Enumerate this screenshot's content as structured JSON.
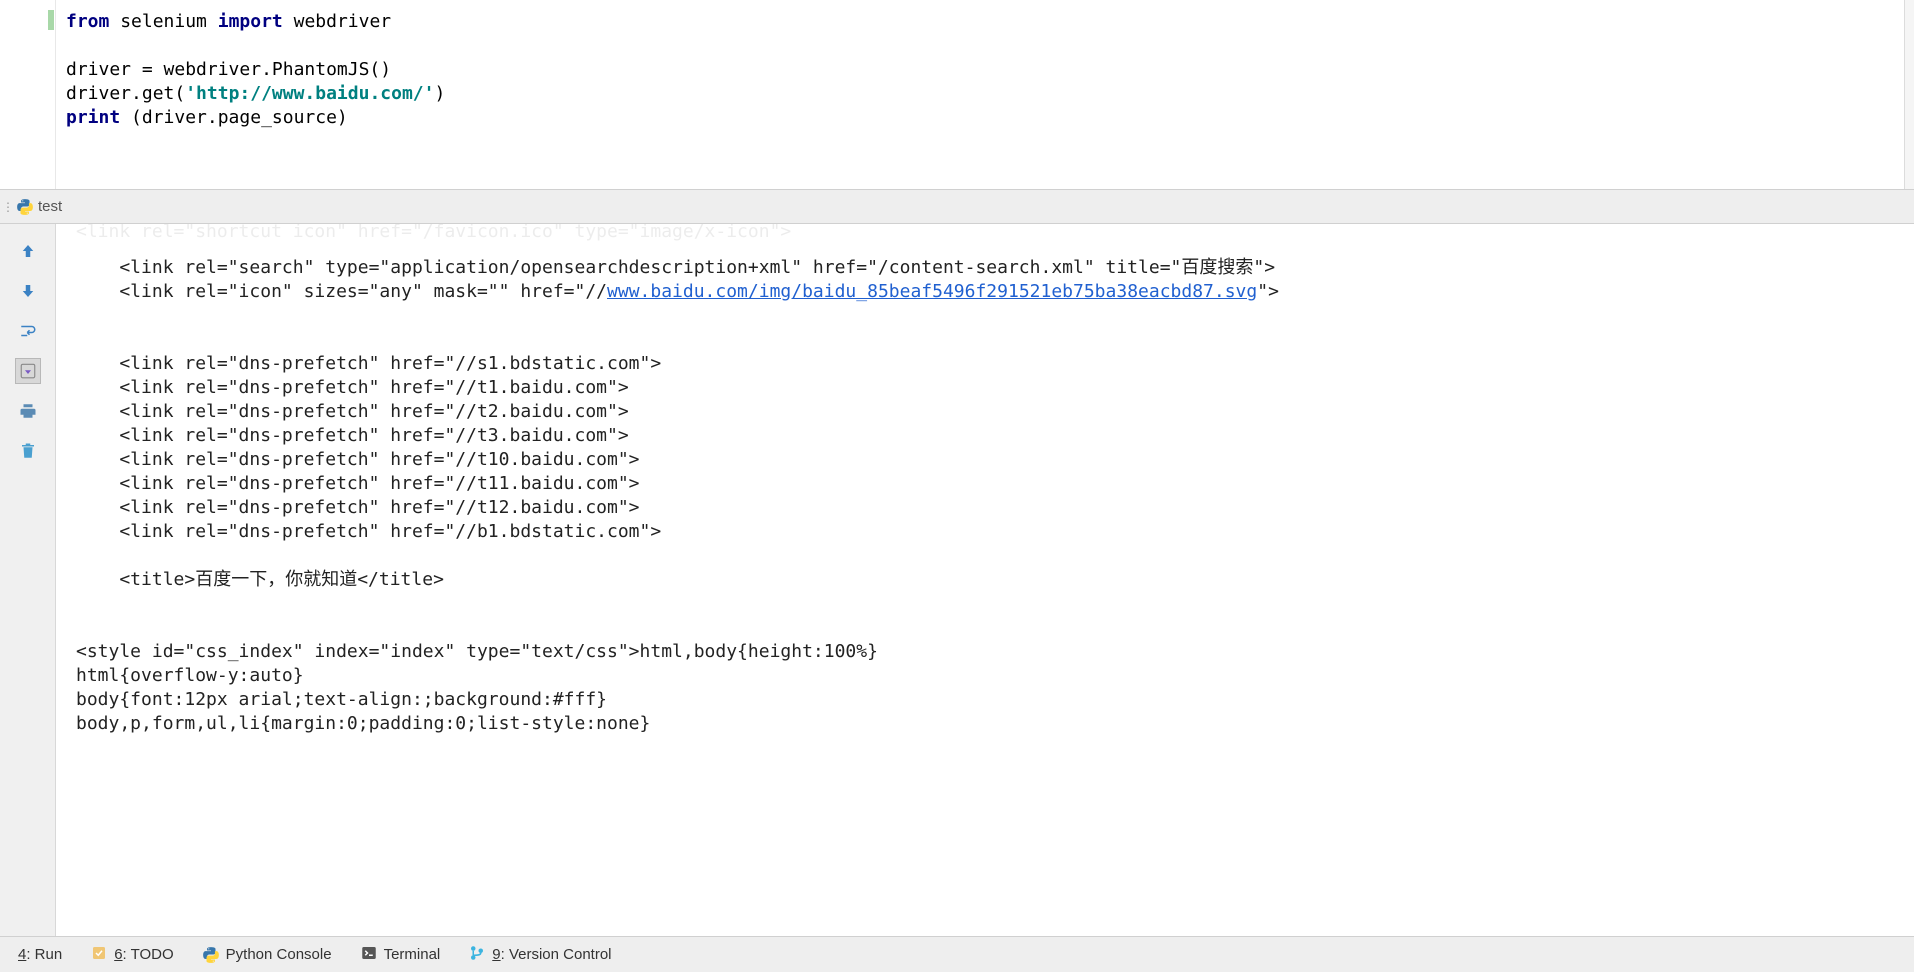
{
  "editor": {
    "code": {
      "line1_from": "from",
      "line1_mod": " selenium ",
      "line1_import": "import",
      "line1_rest": " webdriver",
      "line2": "",
      "line3": "driver = webdriver.PhantomJS()",
      "line4_pre": "driver.get(",
      "line4_str": "'http://www.baidu.com/'",
      "line4_post": ")",
      "line5_print": "print",
      "line5_rest": " (driver.page_source)"
    }
  },
  "run_tab": {
    "label": "test"
  },
  "output": {
    "cutoff_line": "<link rel=\"shortcut icon\" href=\"/favicon.ico\" type=\"image/x-icon\">",
    "line1": "    <link rel=\"search\" type=\"application/opensearchdescription+xml\" href=\"/content-search.xml\" title=\"百度搜索\">",
    "line2_pre": "    <link rel=\"icon\" sizes=\"any\" mask=\"\" href=\"//",
    "line2_link": "www.baidu.com/img/baidu_85beaf5496f291521eb75ba38eacbd87.svg",
    "line2_post": "\">",
    "blank1": "",
    "blank2": "",
    "line3": "    <link rel=\"dns-prefetch\" href=\"//s1.bdstatic.com\">",
    "line4": "    <link rel=\"dns-prefetch\" href=\"//t1.baidu.com\">",
    "line5": "    <link rel=\"dns-prefetch\" href=\"//t2.baidu.com\">",
    "line6": "    <link rel=\"dns-prefetch\" href=\"//t3.baidu.com\">",
    "line7": "    <link rel=\"dns-prefetch\" href=\"//t10.baidu.com\">",
    "line8": "    <link rel=\"dns-prefetch\" href=\"//t11.baidu.com\">",
    "line9": "    <link rel=\"dns-prefetch\" href=\"//t12.baidu.com\">",
    "line10": "    <link rel=\"dns-prefetch\" href=\"//b1.bdstatic.com\">",
    "blank3": "",
    "line11": "    <title>百度一下，你就知道</title>",
    "blank4": "",
    "blank5": "",
    "line12": "<style id=\"css_index\" index=\"index\" type=\"text/css\">html,body{height:100%}",
    "line13": "html{overflow-y:auto}",
    "line14": "body{font:12px arial;text-align:;background:#fff}",
    "line15": "body,p,form,ul,li{margin:0;padding:0;list-style:none}"
  },
  "bottom_bar": {
    "run": {
      "num": "4",
      "label": ": Run"
    },
    "todo": {
      "num": "6",
      "label": ": TODO"
    },
    "python_console": {
      "label": "Python Console"
    },
    "terminal": {
      "label": "Terminal"
    },
    "version_control": {
      "num": "9",
      "label": ": Version Control"
    }
  }
}
